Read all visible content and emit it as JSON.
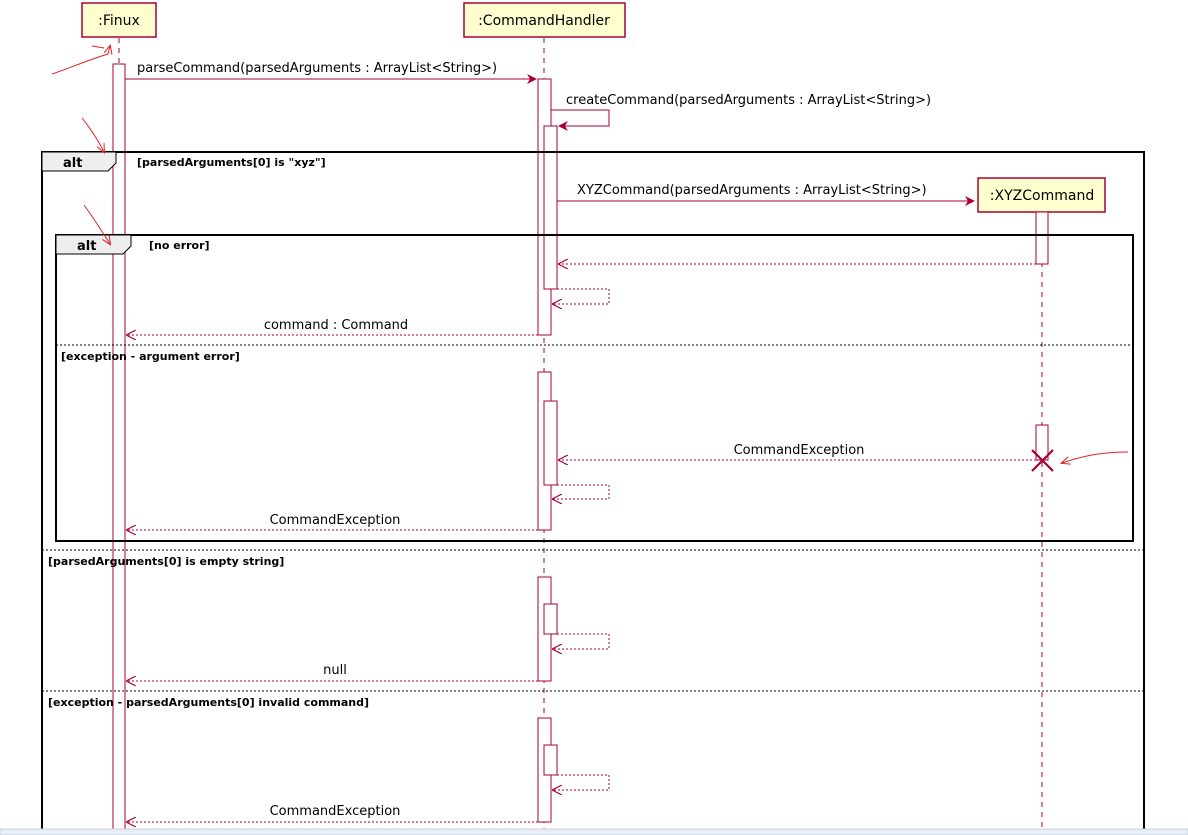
{
  "diagram": {
    "participants": {
      "finux": ":Finux",
      "command_handler": ":CommandHandler",
      "xyz_command": ":XYZCommand"
    },
    "messages": {
      "parse_command": "parseCommand(parsedArguments : ArrayList<String>)",
      "create_command": "createCommand(parsedArguments : ArrayList<String>)",
      "xyz_constructor": "XYZCommand(parsedArguments : ArrayList<String>)",
      "return_command": "command : Command",
      "command_exception_from_xyz": "CommandException",
      "command_exception_return_1": "CommandException",
      "return_null": "null",
      "command_exception_return_2": "CommandException"
    },
    "frames": {
      "outer": {
        "operator": "alt",
        "guards": {
          "first": "[parsedArguments[0] is \"xyz\"]",
          "second": "[parsedArguments[0] is empty string]",
          "third": "[exception - parsedArguments[0] invalid command]"
        }
      },
      "inner": {
        "operator": "alt",
        "guards": {
          "first": "[no error]",
          "second": "[exception - argument error]"
        }
      }
    }
  }
}
